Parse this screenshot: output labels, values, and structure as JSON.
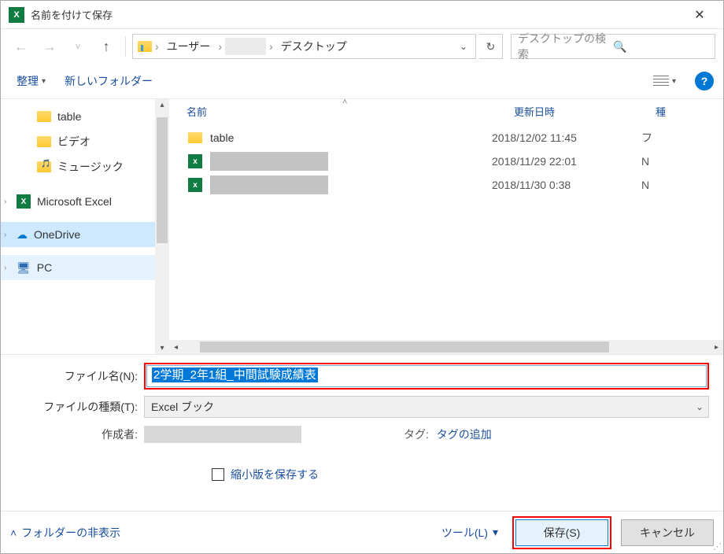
{
  "title": "名前を付けて保存",
  "nav": {
    "breadcrumb": [
      "ユーザー",
      "デスクトップ"
    ],
    "search_placeholder": "デスクトップの検索"
  },
  "toolbar": {
    "organize": "整理",
    "new_folder": "新しいフォルダー"
  },
  "tree": {
    "table": "table",
    "video": "ビデオ",
    "music": "ミュージック",
    "excel": "Microsoft Excel",
    "onedrive": "OneDrive",
    "pc": "PC"
  },
  "list": {
    "hdr_name": "名前",
    "hdr_date": "更新日時",
    "hdr_type": "種",
    "rows": [
      {
        "name": "table",
        "date": "2018/12/02 11:45",
        "type": "フ"
      },
      {
        "name": "",
        "date": "2018/11/29 22:01",
        "type": "N"
      },
      {
        "name": "",
        "date": "2018/11/30 0:38",
        "type": "N"
      }
    ]
  },
  "form": {
    "filename_label": "ファイル名(N):",
    "filename_value": "2学期_2年1組_中間試験成績表",
    "filetype_label": "ファイルの種類(T):",
    "filetype_value": "Excel ブック",
    "author_label": "作成者:",
    "tag_label": "タグ:",
    "tag_value": "タグの追加",
    "thumbnail": "縮小版を保存する"
  },
  "footer": {
    "hide_folders": "フォルダーの非表示",
    "tools": "ツール(L)",
    "save": "保存(S)",
    "cancel": "キャンセル"
  }
}
